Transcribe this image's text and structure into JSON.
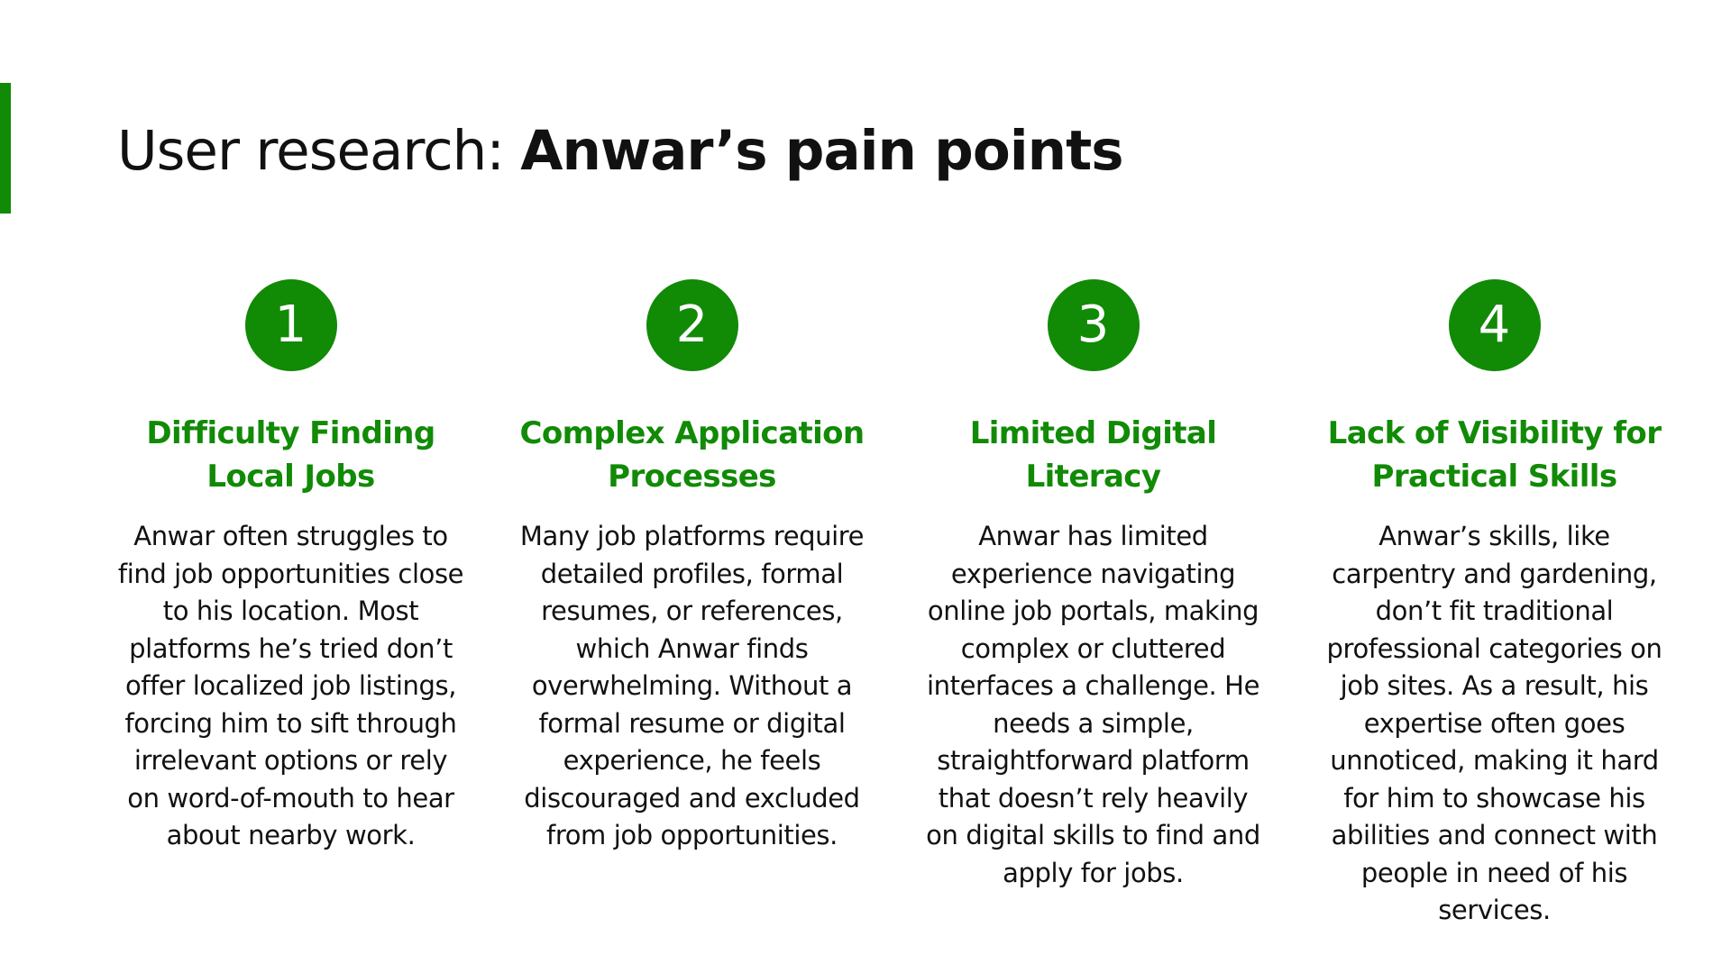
{
  "title": {
    "prefix": "User research: ",
    "emphasis": "Anwar’s pain points"
  },
  "colors": {
    "accent": "#118a06",
    "text": "#111111",
    "background": "#ffffff"
  },
  "pain_points": [
    {
      "number": "1",
      "heading": "Difficulty Finding Local Jobs",
      "body": "Anwar often struggles to find job opportunities close to his location. Most platforms he’s tried don’t offer localized job listings, forcing him to sift through irrelevant options or rely on word-of-mouth to hear about nearby work."
    },
    {
      "number": "2",
      "heading": "Complex Application Processes",
      "body": "Many job platforms require detailed profiles, formal resumes, or references, which Anwar finds overwhelming. Without a formal resume or digital experience, he feels discouraged and excluded from job opportunities."
    },
    {
      "number": "3",
      "heading": "Limited Digital Literacy",
      "body": "Anwar has limited experience navigating online job portals, making complex or cluttered interfaces a challenge. He needs a simple, straightforward platform that doesn’t rely heavily on digital skills to find and apply for jobs."
    },
    {
      "number": "4",
      "heading": "Lack of Visibility for Practical Skills",
      "body": "Anwar’s skills, like carpentry and gardening, don’t fit traditional professional categories on job sites. As a result, his expertise often goes unnoticed, making it hard for him to showcase his abilities and connect with people in need of his services."
    }
  ]
}
